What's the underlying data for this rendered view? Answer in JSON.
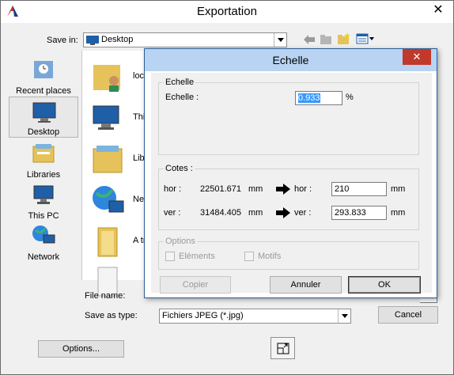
{
  "window": {
    "title": "Exportation"
  },
  "save_in": {
    "label": "Save in:",
    "value": "Desktop"
  },
  "places": [
    {
      "label": "Recent places"
    },
    {
      "label": "Desktop"
    },
    {
      "label": "Libraries"
    },
    {
      "label": "This PC"
    },
    {
      "label": "Network"
    }
  ],
  "files": [
    {
      "name": "loc"
    },
    {
      "name": "Thi"
    },
    {
      "name": "Lib"
    },
    {
      "name": "Net"
    },
    {
      "name": "A tr"
    },
    {
      "name": ""
    }
  ],
  "form": {
    "file_name_label": "File name:",
    "file_name_value": "",
    "save_type_label": "Save as type:",
    "save_type_value": "Fichiers JPEG (*.jpg)",
    "options_button": "Options...",
    "cancel_button": "Cancel"
  },
  "dialog": {
    "title": "Echelle",
    "close_glyph": "✕",
    "scale_group": {
      "title": "Echelle",
      "label": "Echelle :",
      "value": "0.933",
      "unit": "%"
    },
    "cotes_group": {
      "title": "Cotes :",
      "row_hor": {
        "label": "hor :",
        "value": "22501.671",
        "unit": "mm",
        "target_label": "hor :",
        "target_value": "210",
        "target_unit": "mm"
      },
      "row_ver": {
        "label": "ver :",
        "value": "31484.405",
        "unit": "mm",
        "target_label": "ver :",
        "target_value": "293.833",
        "target_unit": "mm"
      }
    },
    "options_group": {
      "title": "Options",
      "elements_label": "Eléments",
      "motifs_label": "Motifs"
    },
    "copy_button": "Copier",
    "cancel_button": "Annuler",
    "ok_button": "OK"
  }
}
